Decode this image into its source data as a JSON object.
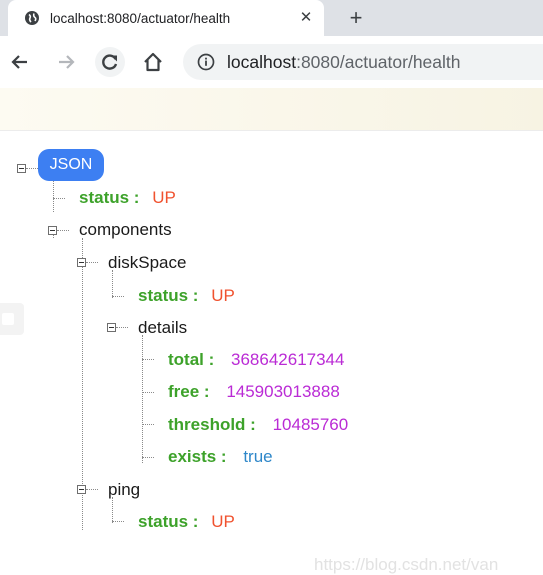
{
  "browser": {
    "tab_title": "localhost:8080/actuator/health",
    "tab_close": "✕",
    "new_tab": "+",
    "url_host": "localhost",
    "url_rest": ":8080/actuator/health"
  },
  "tree": {
    "root_label": "JSON",
    "status_key": "status :",
    "status_value": "UP",
    "components_key": "components",
    "diskspace_key": "diskSpace",
    "diskspace_status_key": "status :",
    "diskspace_status_value": "UP",
    "details_key": "details",
    "total_key": "total :",
    "total_value": "368642617344",
    "free_key": "free :",
    "free_value": "145903013888",
    "threshold_key": "threshold :",
    "threshold_value": "10485760",
    "exists_key": "exists :",
    "exists_value": "true",
    "ping_key": "ping",
    "ping_status_key": "status :",
    "ping_status_value": "UP"
  },
  "watermark": "https://blog.csdn.net/van"
}
